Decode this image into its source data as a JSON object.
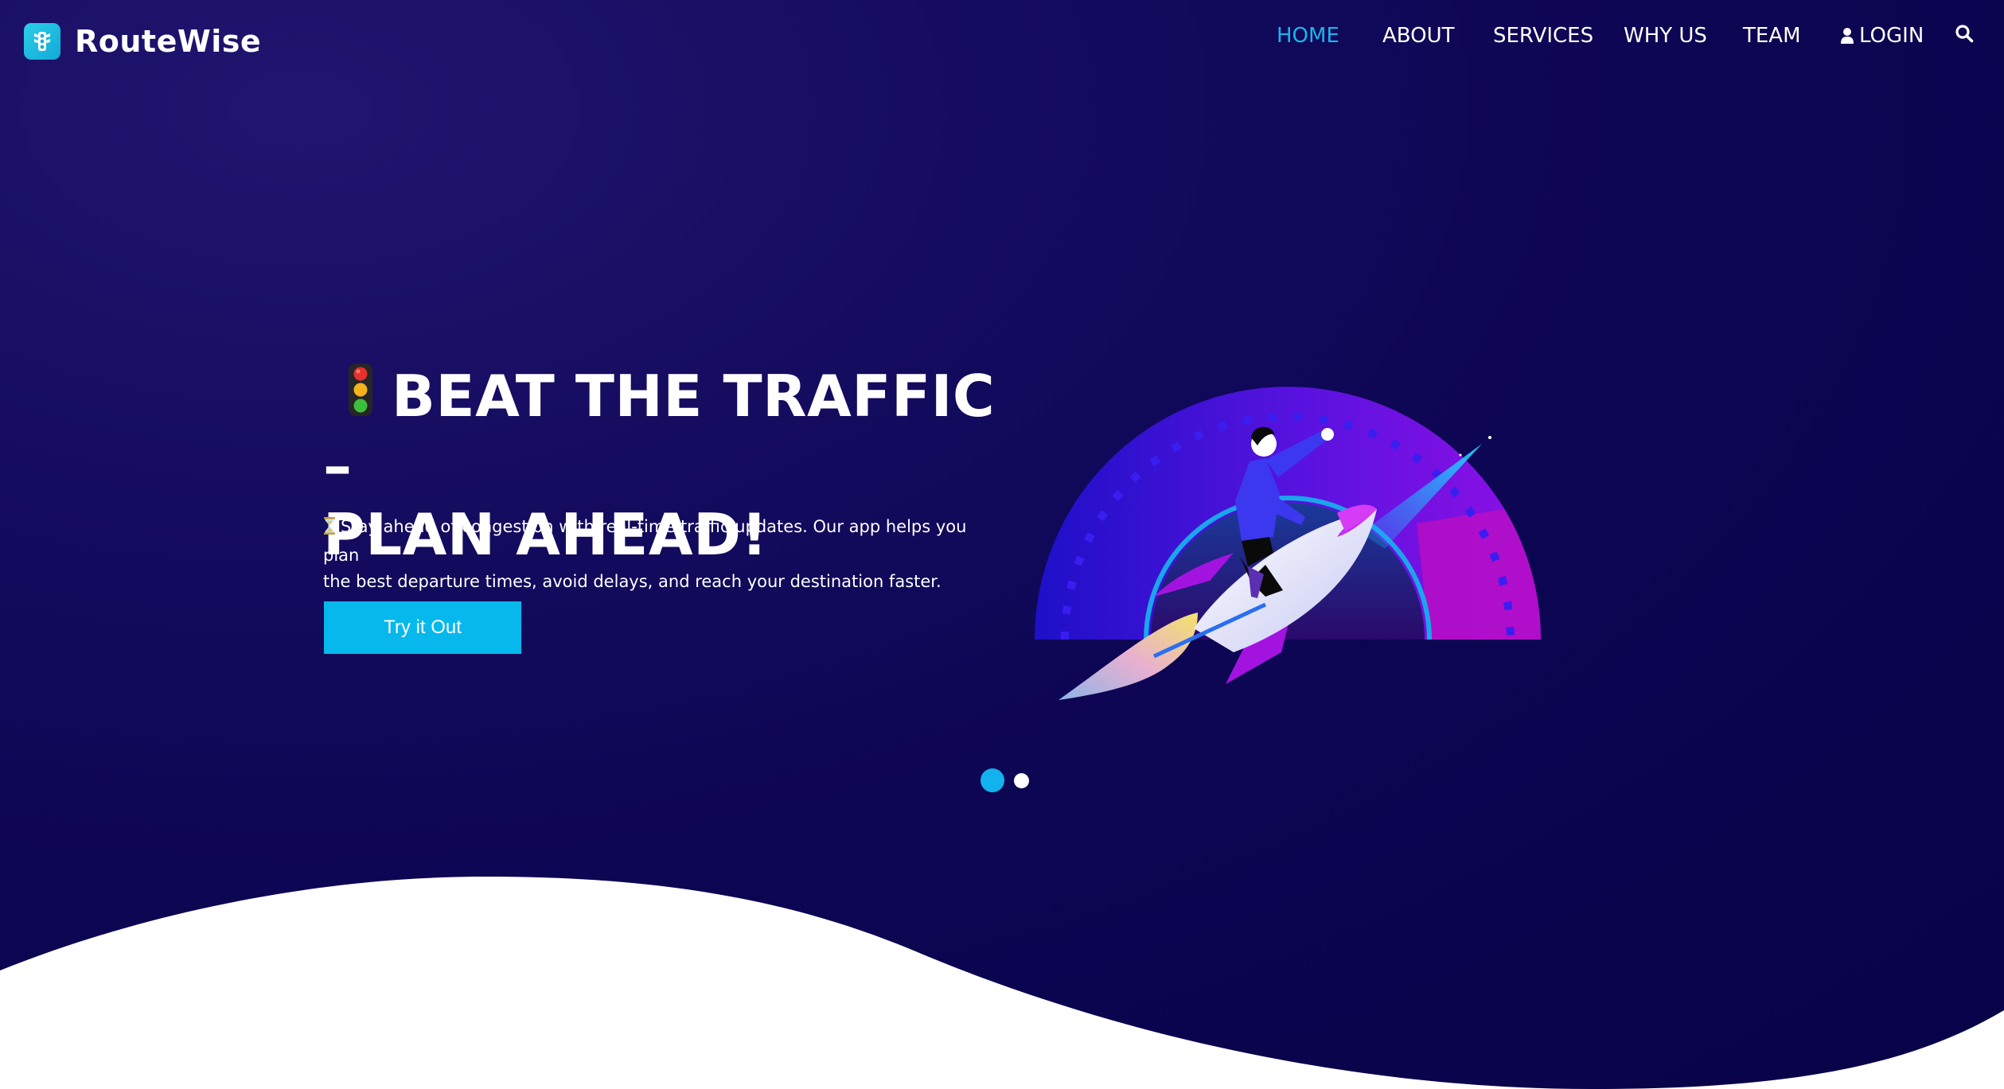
{
  "brand": {
    "name": "RouteWise",
    "icon": "traffic-light-icon",
    "icon_color": "#1fbfe0"
  },
  "nav": {
    "items": [
      {
        "label": "HOME",
        "active": true
      },
      {
        "label": "ABOUT",
        "active": false
      },
      {
        "label": "SERVICES",
        "active": false
      },
      {
        "label": "WHY US",
        "active": false
      },
      {
        "label": "TEAM",
        "active": false
      }
    ],
    "login_label": "LOGIN",
    "login_icon": "user-icon",
    "search_icon": "search-icon"
  },
  "hero": {
    "title_line1": "BEAT THE TRAFFIC –",
    "title_line2": "PLAN AHEAD!",
    "title_icon": "traffic-light-icon",
    "description_line1": "Stay ahead of congestion with real-time traffic updates. Our app helps you plan",
    "description_line2": "the best departure times, avoid delays, and reach your destination faster.",
    "description_icon": "hourglass-icon",
    "cta_label": "Try it Out"
  },
  "carousel": {
    "slide_count": 2,
    "active_index": 0
  },
  "colors": {
    "background": "#0c0552",
    "accent": "#06b8ec",
    "nav_active": "#1ab5ea",
    "text": "#ffffff"
  }
}
